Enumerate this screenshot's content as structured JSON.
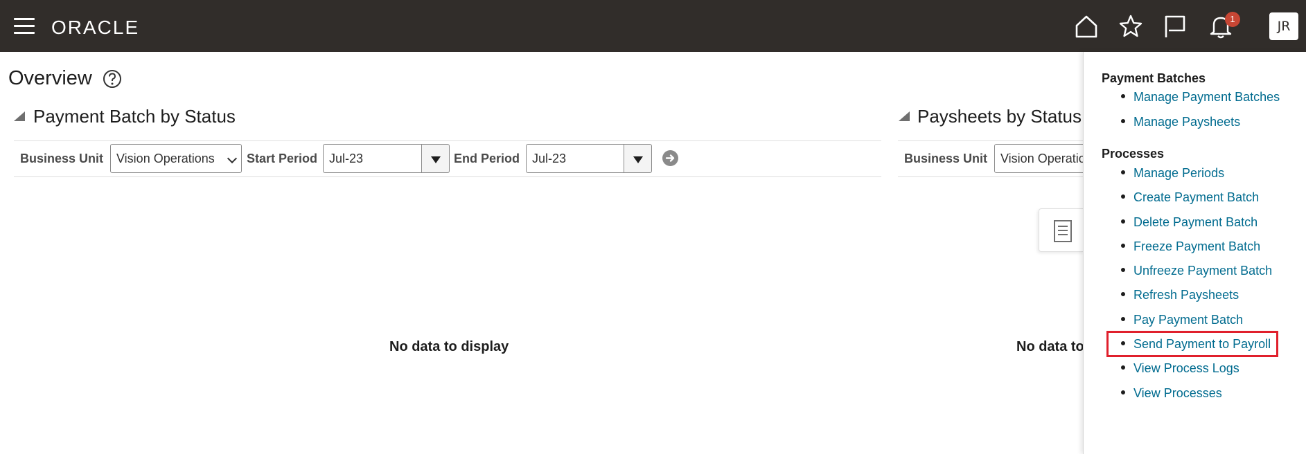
{
  "header": {
    "logo": "ORACLE",
    "notification_count": "1",
    "user_initials": "JR",
    "icons": [
      "menu-icon",
      "home-icon",
      "star-icon",
      "flag-icon",
      "bell-icon"
    ]
  },
  "page": {
    "title": "Overview"
  },
  "left_section": {
    "title": "Payment Batch by Status",
    "business_unit_label": "Business Unit",
    "business_unit_value": "Vision Operations",
    "start_period_label": "Start Period",
    "start_period_value": "Jul-23",
    "end_period_label": "End Period",
    "end_period_value": "Jul-23",
    "empty_message": "No data to display"
  },
  "right_section": {
    "title": "Paysheets by Status",
    "business_unit_label": "Business Unit",
    "business_unit_value": "Vision Operations",
    "empty_message": "No data to display"
  },
  "task_panel": {
    "groups": [
      {
        "heading": "Payment Batches",
        "items": [
          "Manage Payment Batches",
          "Manage Paysheets"
        ]
      },
      {
        "heading": "Processes",
        "items": [
          "Manage Periods",
          "Create Payment Batch",
          "Delete Payment Batch",
          "Freeze Payment Batch",
          "Unfreeze Payment Batch",
          "Refresh Paysheets",
          "Pay Payment Batch",
          "Send Payment to Payroll",
          "View Process Logs",
          "View Processes"
        ]
      }
    ],
    "highlighted_item": "Send Payment to Payroll"
  },
  "colors": {
    "header_bg": "#312d2a",
    "link": "#006b8f",
    "badge": "#c74634",
    "highlight_border": "#e0202c"
  }
}
